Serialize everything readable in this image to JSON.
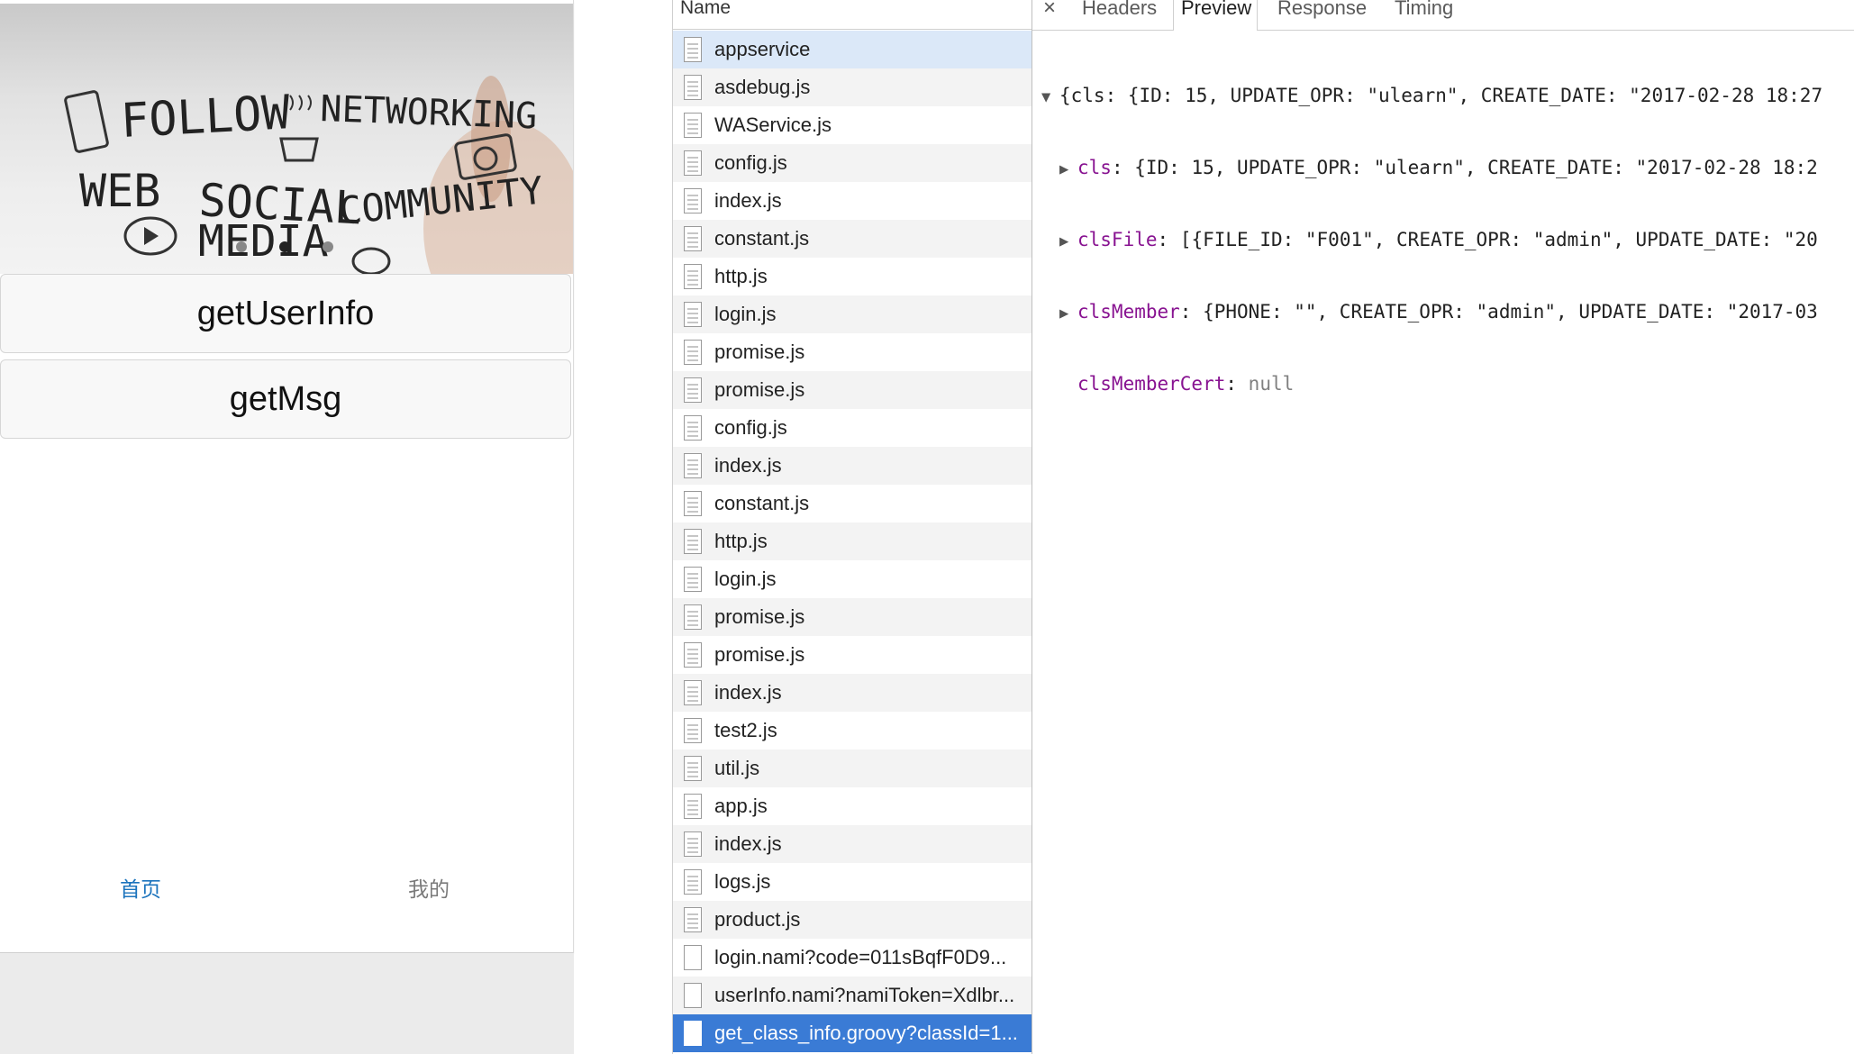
{
  "simulator": {
    "banner_words": [
      "FOLLOW",
      "NETWORKING",
      "WEB",
      "SOCIAL",
      "MEDIA",
      "COMMUNITY"
    ],
    "buttons": [
      "getUserInfo",
      "getMsg"
    ],
    "tabbar": {
      "home": "首页",
      "mine": "我的",
      "active_color": "#1c74bd"
    }
  },
  "network": {
    "header": "Name",
    "rows": [
      {
        "name": "appservice",
        "icon": "file-icon"
      },
      {
        "name": "asdebug.js",
        "icon": "file-icon"
      },
      {
        "name": "WAService.js",
        "icon": "file-icon"
      },
      {
        "name": "config.js",
        "icon": "file-icon"
      },
      {
        "name": "index.js",
        "icon": "file-icon"
      },
      {
        "name": "constant.js",
        "icon": "file-icon"
      },
      {
        "name": "http.js",
        "icon": "file-icon"
      },
      {
        "name": "login.js",
        "icon": "file-icon"
      },
      {
        "name": "promise.js",
        "icon": "file-icon"
      },
      {
        "name": "promise.js",
        "icon": "file-icon"
      },
      {
        "name": "config.js",
        "icon": "file-icon"
      },
      {
        "name": "index.js",
        "icon": "file-icon"
      },
      {
        "name": "constant.js",
        "icon": "file-icon"
      },
      {
        "name": "http.js",
        "icon": "file-icon"
      },
      {
        "name": "login.js",
        "icon": "file-icon"
      },
      {
        "name": "promise.js",
        "icon": "file-icon"
      },
      {
        "name": "promise.js",
        "icon": "file-icon"
      },
      {
        "name": "index.js",
        "icon": "file-icon"
      },
      {
        "name": "test2.js",
        "icon": "file-icon"
      },
      {
        "name": "util.js",
        "icon": "file-icon"
      },
      {
        "name": "app.js",
        "icon": "file-icon"
      },
      {
        "name": "index.js",
        "icon": "file-icon"
      },
      {
        "name": "logs.js",
        "icon": "file-icon"
      },
      {
        "name": "product.js",
        "icon": "file-icon"
      },
      {
        "name": "login.nami?code=011sBqfF0D9...",
        "icon": "blank-file-icon"
      },
      {
        "name": "userInfo.nami?namiToken=Xdlbr...",
        "icon": "blank-file-icon"
      },
      {
        "name": "get_class_info.groovy?classId=1...",
        "icon": "blank-file-icon"
      }
    ],
    "highlighted_index": 0,
    "selected_index": 26,
    "selected_color": "#3a7bd5"
  },
  "preview": {
    "tabs": {
      "close": "×",
      "headers": "Headers",
      "preview": "Preview",
      "response": "Response",
      "timing": "Timing"
    },
    "active_tab": "Preview",
    "root_summary": "{cls: {ID: 15, UPDATE_OPR: \"ulearn\", CREATE_DATE: \"2017-02-28 18:27",
    "items": [
      {
        "key": "cls",
        "value": "{ID: 15, UPDATE_OPR: \"ulearn\", CREATE_DATE: \"2017-02-28 18:2",
        "expandable": true
      },
      {
        "key": "clsFile",
        "value": "[{FILE_ID: \"F001\", CREATE_OPR: \"admin\", UPDATE_DATE: \"20",
        "expandable": true
      },
      {
        "key": "clsMember",
        "value": "{PHONE: \"\", CREATE_OPR: \"admin\", UPDATE_DATE: \"2017-03",
        "expandable": true
      },
      {
        "key": "clsMemberCert",
        "value": "null",
        "expandable": false
      }
    ],
    "key_color": "#881391"
  }
}
